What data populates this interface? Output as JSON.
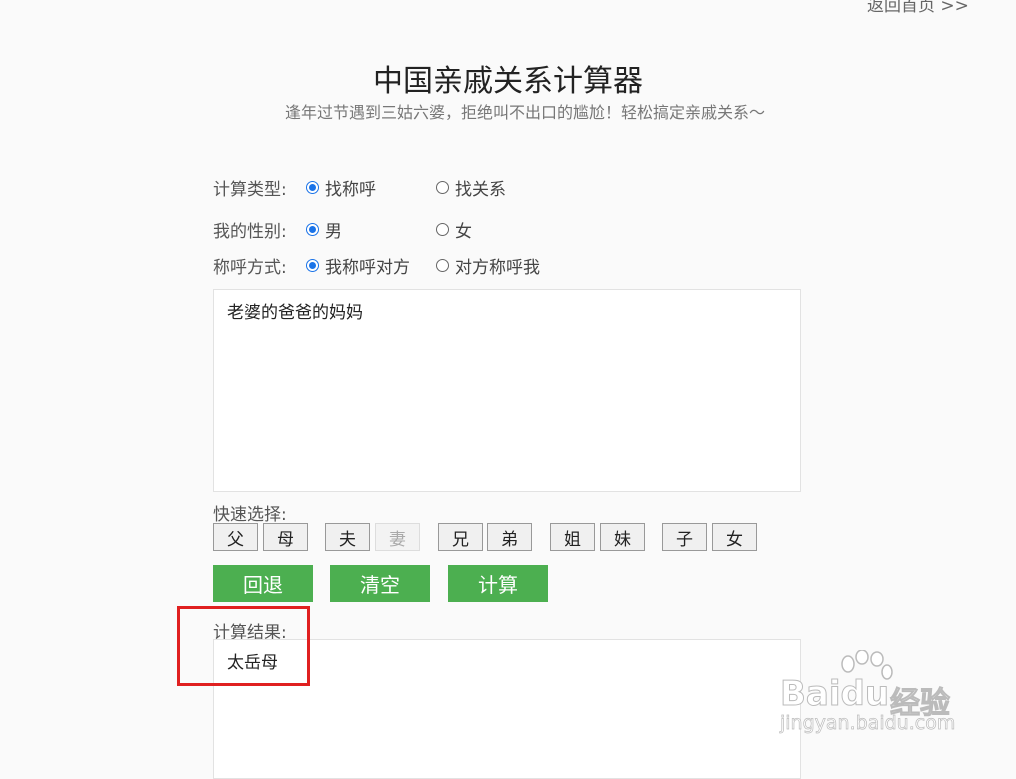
{
  "header": {
    "back_link": "返回首页 >>",
    "title": "中国亲戚关系计算器",
    "subtitle": "逢年过节遇到三姑六婆，拒绝叫不出口的尴尬！轻松搞定亲戚关系～"
  },
  "form": {
    "calc_type": {
      "label": "计算类型:",
      "options": [
        "找称呼",
        "找关系"
      ],
      "selected": "找称呼"
    },
    "gender": {
      "label": "我的性别:",
      "options": [
        "男",
        "女"
      ],
      "selected": "男"
    },
    "address_mode": {
      "label": "称呼方式:",
      "options": [
        "我称呼对方",
        "对方称呼我"
      ],
      "selected": "我称呼对方"
    },
    "input_text": "老婆的爸爸的妈妈"
  },
  "quick_select": {
    "label": "快速选择:",
    "buttons": [
      "父",
      "母",
      "夫",
      "妻",
      "兄",
      "弟",
      "姐",
      "妹",
      "子",
      "女"
    ],
    "disabled": [
      "妻"
    ]
  },
  "actions": {
    "back": "回退",
    "clear": "清空",
    "calc": "计算"
  },
  "result": {
    "label": "计算结果:",
    "value": "太岳母"
  },
  "watermark": {
    "brand": "Baidu",
    "product": "经验",
    "url": "jingyan.baidu.com"
  },
  "colors": {
    "accent_green": "#4caf50",
    "radio_blue": "#1a73e8",
    "highlight_red": "#e02020"
  }
}
